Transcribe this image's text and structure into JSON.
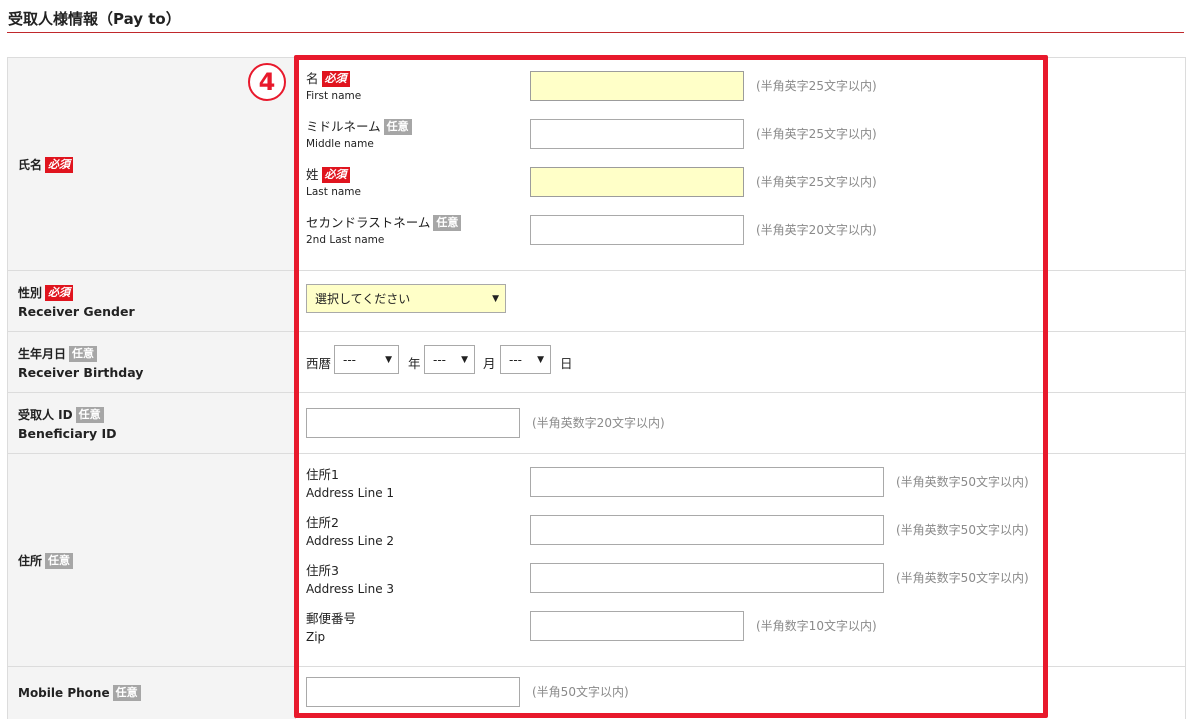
{
  "section": {
    "title": "受取人様情報（Pay to）"
  },
  "badges": {
    "required": "必須",
    "optional": "任意"
  },
  "step": {
    "number": "4"
  },
  "name": {
    "label": "氏名",
    "first": {
      "jp": "名",
      "en": "First name",
      "hint": "(半角英字25文字以内)"
    },
    "middle": {
      "jp": "ミドルネーム",
      "en": "Middle name",
      "hint": "(半角英字25文字以内)"
    },
    "last": {
      "jp": "姓",
      "en": "Last name",
      "hint": "(半角英字25文字以内)"
    },
    "second_last": {
      "jp": "セカンドラストネーム",
      "en": "2nd Last name",
      "hint": "(半角英字20文字以内)"
    }
  },
  "gender": {
    "label_jp": "性別",
    "label_en": "Receiver Gender",
    "select_value": "選択してください"
  },
  "birthday": {
    "label_jp": "生年月日",
    "label_en": "Receiver Birthday",
    "era_label": "西暦",
    "year_value": "---",
    "year_label": "年",
    "month_value": "---",
    "month_label": "月",
    "day_value": "---",
    "day_label": "日"
  },
  "beneficiary": {
    "label_jp": "受取人 ID",
    "label_en": "Beneficiary ID",
    "hint": "(半角英数字20文字以内)"
  },
  "address": {
    "label": "住所",
    "line1": {
      "jp": "住所1",
      "en": "Address Line 1",
      "hint": "(半角英数字50文字以内)"
    },
    "line2": {
      "jp": "住所2",
      "en": "Address Line 2",
      "hint": "(半角英数字50文字以内)"
    },
    "line3": {
      "jp": "住所3",
      "en": "Address Line 3",
      "hint": "(半角英数字50文字以内)"
    },
    "zip": {
      "jp": "郵便番号",
      "en": "Zip",
      "hint": "(半角数字10文字以内)"
    }
  },
  "mobile": {
    "label": "Mobile Phone",
    "hint": "(半角50文字以内)"
  },
  "colors": {
    "accent_red": "#e8192c",
    "required_badge": "#e0141e",
    "optional_badge": "#a6a6a6",
    "required_field_bg": "#ffffc8"
  }
}
